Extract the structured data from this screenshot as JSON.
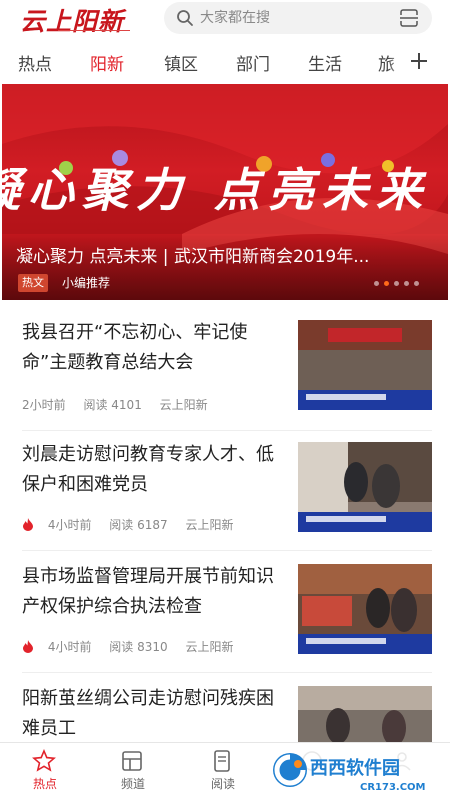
{
  "header": {
    "logo_text": "云上阳新",
    "search_placeholder": "大家都在搜"
  },
  "tabs": [
    {
      "label": "热点",
      "active": false
    },
    {
      "label": "阳新",
      "active": true
    },
    {
      "label": "镇区",
      "active": false
    },
    {
      "label": "部门",
      "active": false
    },
    {
      "label": "生活",
      "active": false
    },
    {
      "label": "旅",
      "active": false
    }
  ],
  "banner": {
    "slogan": "凝心聚力 点亮未来",
    "title": "凝心聚力 点亮未来 | 武汉市阳新商会2019年...",
    "tag": "热文",
    "recommender": "小编推荐",
    "dots_count": 5,
    "active_dot": 1
  },
  "news": [
    {
      "title": "我县召开“不忘初心、牢记使命”主题教育总结大会",
      "time": "2小时前",
      "reads": "阅读 4101",
      "source": "云上阳新",
      "hot": false
    },
    {
      "title": "刘晨走访慰问教育专家人才、低保户和困难党员",
      "time": "4小时前",
      "reads": "阅读 6187",
      "source": "云上阳新",
      "hot": true
    },
    {
      "title": "县市场监督管理局开展节前知识产权保护综合执法检查",
      "time": "4小时前",
      "reads": "阅读 8310",
      "source": "云上阳新",
      "hot": true
    },
    {
      "title": "阳新茧丝绸公司走访慰问残疾困难员工",
      "time": "",
      "reads": "",
      "source": "",
      "hot": false
    }
  ],
  "bottom_nav": [
    {
      "label": "热点",
      "icon": "star-icon",
      "active": true
    },
    {
      "label": "频道",
      "icon": "channel-icon",
      "active": false
    },
    {
      "label": "阅读",
      "icon": "read-icon",
      "active": false
    },
    {
      "label": "",
      "icon": "service-icon",
      "active": false
    },
    {
      "label": "",
      "icon": "user-icon",
      "active": false
    }
  ],
  "watermark": {
    "brand": "西西软件园",
    "domain": "CR173.COM"
  },
  "colors": {
    "accent": "#e2232b",
    "banner_red": "#c8161d"
  }
}
